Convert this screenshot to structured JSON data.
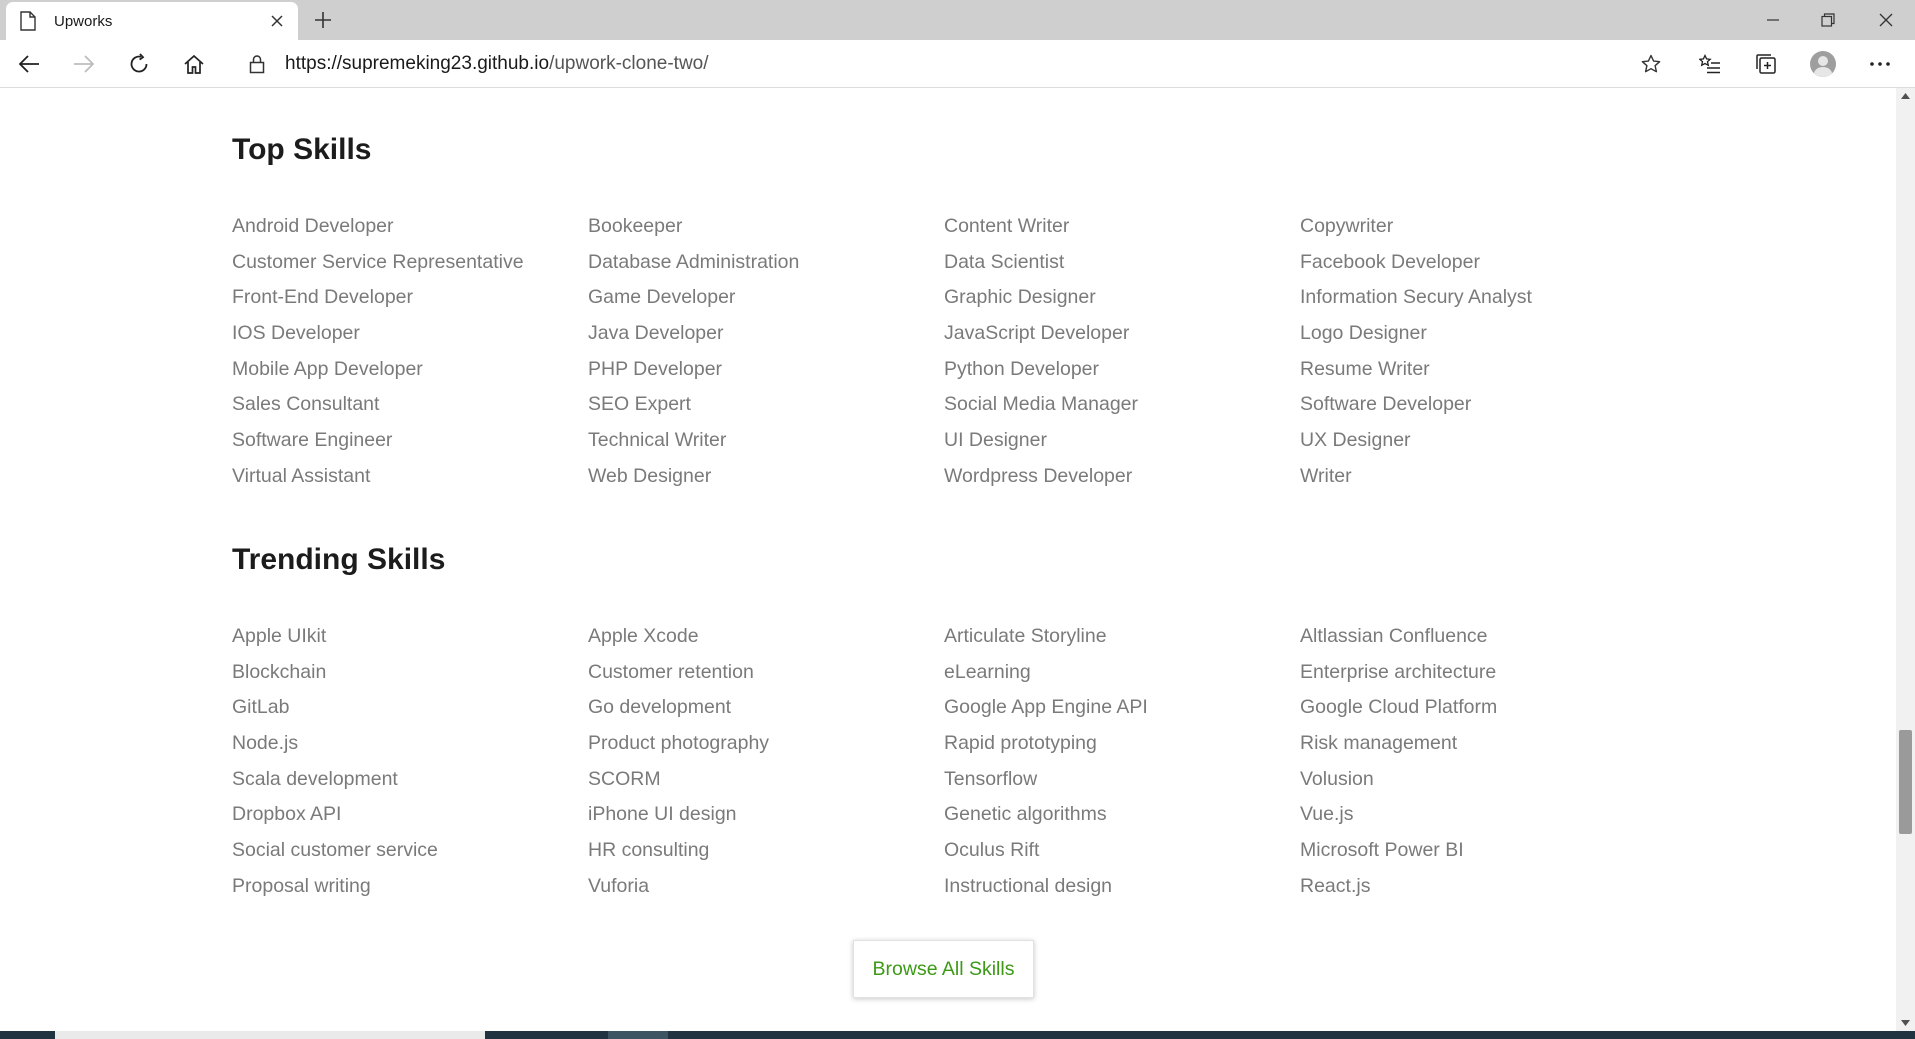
{
  "browser": {
    "tab_title": "Upworks",
    "url_host": "https://supremeking23.github.io",
    "url_path": "/upwork-clone-two/"
  },
  "top_skills": {
    "title": "Top Skills",
    "items": [
      "Android Developer",
      "Bookeeper",
      "Content Writer",
      "Copywriter",
      "Customer Service Representative",
      "Database Administration",
      "Data Scientist",
      "Facebook Developer",
      "Front-End Developer",
      "Game Developer",
      "Graphic Designer",
      "Information Secury Analyst",
      "IOS Developer",
      "Java Developer",
      "JavaScript Developer",
      "Logo Designer",
      "Mobile App Developer",
      "PHP Developer",
      "Python Developer",
      "Resume Writer",
      "Sales Consultant",
      "SEO Expert",
      "Social Media Manager",
      "Software Developer",
      "Software Engineer",
      "Technical Writer",
      "UI Designer",
      "UX Designer",
      "Virtual Assistant",
      "Web Designer",
      "Wordpress Developer",
      "Writer"
    ]
  },
  "trending_skills": {
    "title": "Trending Skills",
    "items": [
      "Apple UIkit",
      "Apple Xcode",
      "Articulate Storyline",
      "Altlassian Confluence",
      "Blockchain",
      "Customer retention",
      "eLearning",
      "Enterprise architecture",
      "GitLab",
      "Go development",
      "Google App Engine API",
      "Google Cloud Platform",
      "Node.js",
      "Product photography",
      "Rapid prototyping",
      "Risk management",
      "Scala development",
      "SCORM",
      "Tensorflow",
      "Volusion",
      "Dropbox API",
      "iPhone UI design",
      "Genetic algorithms",
      "Vue.js",
      "Social customer service",
      "HR consulting",
      "Oculus Rift",
      "Microsoft Power BI",
      "Proposal writing",
      "Vuforia",
      "Instructional design",
      "React.js"
    ]
  },
  "browse_button": "Browse All Skills",
  "colors": {
    "link_gray": "#7a7a7a",
    "button_green": "#3c9a16",
    "heading": "#1c1c1c"
  }
}
